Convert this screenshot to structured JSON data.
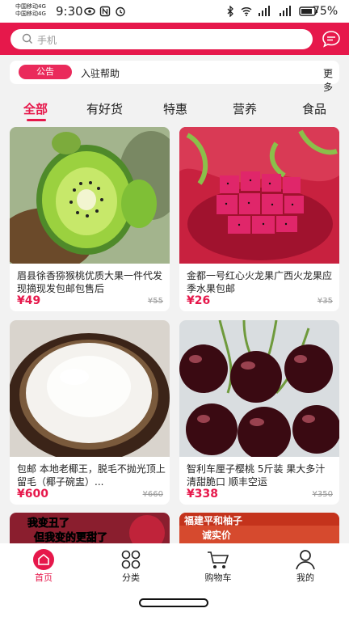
{
  "status": {
    "carrier_1": "中国移动4G",
    "carrier_2": "中国移动4G",
    "time": "9:30",
    "battery": "75%"
  },
  "search": {
    "placeholder": "手机"
  },
  "notice": {
    "badge": "公告",
    "text": "入驻帮助",
    "more": "更多"
  },
  "tabs": [
    "全部",
    "有好货",
    "特惠",
    "营养",
    "食品"
  ],
  "products": [
    {
      "title": "眉县徐香猕猴桃优质大果一件代发现摘现发包邮包售后",
      "price": "¥49",
      "original": "¥55"
    },
    {
      "title": "金都一号红心火龙果广西火龙果应季水果包邮",
      "price": "¥26",
      "original": "¥35"
    },
    {
      "title": "包邮 本地老椰王，脱毛不抛光顶上留毛（椰子碗盅）...",
      "price": "¥600",
      "original": "¥660"
    },
    {
      "title": "智利车厘子樱桃 5斤装 果大多汁 清甜脆口 顺丰空运",
      "price": "¥338",
      "original": "¥350"
    }
  ],
  "partial_banners": {
    "left_line1": "我变丑了",
    "left_line2": "但我变的更甜了",
    "right_line1": "福建平和柚子",
    "right_line2": "诚实价"
  },
  "bottom_nav": [
    {
      "label": "首页",
      "icon": "home-icon"
    },
    {
      "label": "分类",
      "icon": "grid-icon"
    },
    {
      "label": "购物车",
      "icon": "cart-icon"
    },
    {
      "label": "我的",
      "icon": "user-icon"
    }
  ],
  "colors": {
    "brand": "#e6184b",
    "background": "#f2f2f2"
  }
}
